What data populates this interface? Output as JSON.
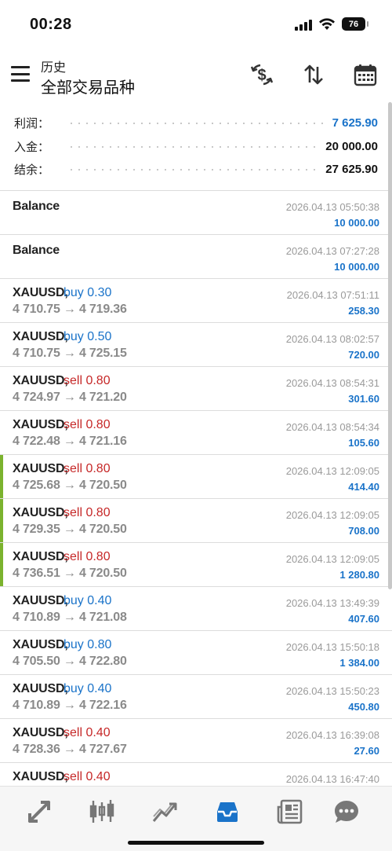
{
  "status": {
    "time": "00:28",
    "battery": "76"
  },
  "header": {
    "title": "历史",
    "subtitle": "全部交易品种"
  },
  "summary": {
    "profit_label": "利润：",
    "profit_value": "7 625.90",
    "deposit_label": "入金：",
    "deposit_value": "20 000.00",
    "balance_label": "结余：",
    "balance_value": "27 625.90"
  },
  "colors": {
    "accent": "#1a73c9",
    "sell": "#c62828",
    "marker": "#7bb32e"
  },
  "rows": [
    {
      "symbol": "Balance",
      "side": "",
      "prices": "",
      "time": "2026.04.13 05:50:38",
      "profit": "10 000.00"
    },
    {
      "symbol": "Balance",
      "side": "",
      "prices": "",
      "time": "2026.04.13 07:27:28",
      "profit": "10 000.00"
    },
    {
      "symbol": "XAUUSD,",
      "side": "buy 0.30",
      "prices": "4 710.75 → 4 719.36",
      "time": "2026.04.13 07:51:11",
      "profit": "258.30"
    },
    {
      "symbol": "XAUUSD,",
      "side": "buy 0.50",
      "prices": "4 710.75 → 4 725.15",
      "time": "2026.04.13 08:02:57",
      "profit": "720.00"
    },
    {
      "symbol": "XAUUSD,",
      "side": "sell 0.80",
      "prices": "4 724.97 → 4 721.20",
      "time": "2026.04.13 08:54:31",
      "profit": "301.60"
    },
    {
      "symbol": "XAUUSD,",
      "side": "sell 0.80",
      "prices": "4 722.48 → 4 721.16",
      "time": "2026.04.13 08:54:34",
      "profit": "105.60"
    },
    {
      "symbol": "XAUUSD,",
      "side": "sell 0.80",
      "prices": "4 725.68 → 4 720.50",
      "time": "2026.04.13 12:09:05",
      "profit": "414.40"
    },
    {
      "symbol": "XAUUSD,",
      "side": "sell 0.80",
      "prices": "4 729.35 → 4 720.50",
      "time": "2026.04.13 12:09:05",
      "profit": "708.00"
    },
    {
      "symbol": "XAUUSD,",
      "side": "sell 0.80",
      "prices": "4 736.51 → 4 720.50",
      "time": "2026.04.13 12:09:05",
      "profit": "1 280.80"
    },
    {
      "symbol": "XAUUSD,",
      "side": "buy 0.40",
      "prices": "4 710.89 → 4 721.08",
      "time": "2026.04.13 13:49:39",
      "profit": "407.60"
    },
    {
      "symbol": "XAUUSD,",
      "side": "buy 0.80",
      "prices": "4 705.50 → 4 722.80",
      "time": "2026.04.13 15:50:18",
      "profit": "1 384.00"
    },
    {
      "symbol": "XAUUSD,",
      "side": "buy 0.40",
      "prices": "4 710.89 → 4 722.16",
      "time": "2026.04.13 15:50:23",
      "profit": "450.80"
    },
    {
      "symbol": "XAUUSD,",
      "side": "sell 0.40",
      "prices": "4 728.36 → 4 727.67",
      "time": "2026.04.13 16:39:08",
      "profit": "27.60"
    },
    {
      "symbol": "XAUUSD,",
      "side": "sell 0.40",
      "prices": "",
      "time": "2026.04.13 16:47:40",
      "profit": ""
    }
  ],
  "tabs": [
    {
      "name": "quotes",
      "icon": "quotes-arrows-icon"
    },
    {
      "name": "chart",
      "icon": "candlestick-icon"
    },
    {
      "name": "trade",
      "icon": "trade-trend-icon"
    },
    {
      "name": "history",
      "icon": "inbox-tray-icon",
      "active": true
    },
    {
      "name": "news",
      "icon": "newspaper-icon"
    },
    {
      "name": "messages",
      "icon": "chat-bubble-icon"
    }
  ]
}
